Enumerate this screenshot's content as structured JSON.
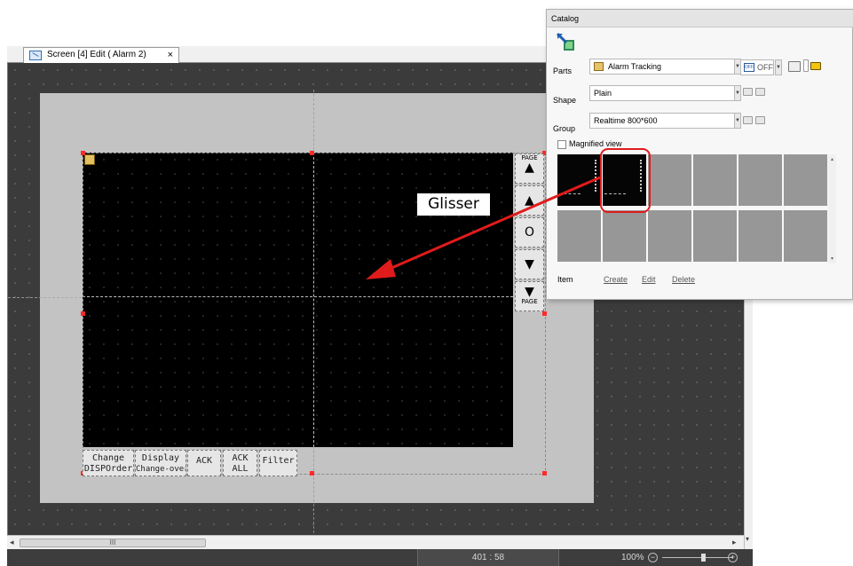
{
  "editor": {
    "tab": {
      "label": "Screen [4] Edit (      Alarm 2)",
      "close": "×"
    },
    "sidebuttons": [
      {
        "name": "page-up",
        "small": "PAGE",
        "glyph": "▲"
      },
      {
        "name": "up",
        "glyph": "▲"
      },
      {
        "name": "center",
        "glyph": "O"
      },
      {
        "name": "down",
        "glyph": "▼"
      },
      {
        "name": "page-down",
        "glyph": "▼",
        "small": "PAGE"
      }
    ],
    "bottombuttons": [
      {
        "line1": "Change",
        "line2": "DISPOrder"
      },
      {
        "line1": "Display",
        "line2": "Change-over"
      },
      {
        "line1": "ACK"
      },
      {
        "line1": "ACK",
        "line2": "ALL"
      },
      {
        "line1": "Filter"
      }
    ],
    "hscroll": {
      "left_arrow": "◂",
      "right_arrow": "▸",
      "grip": "III"
    },
    "vscroll": {
      "up_arrow": "▴",
      "down_arrow": "▾"
    },
    "status": {
      "coord": "401 : 58",
      "zoom": "100%"
    }
  },
  "catalog": {
    "title": "Catalog",
    "parts_label": "Parts",
    "parts_value": "Alarm Tracking",
    "offstate": "OFF",
    "officon": "OFF",
    "shape_label": "Shape",
    "shape_value": "Plain",
    "group_label": "Group",
    "group_value": "Realtime 800*600",
    "magnified_label": "Magnified view",
    "item_label": "Item",
    "create_label": "Create",
    "edit_label": "Edit",
    "delete_label": "Delete"
  },
  "annotation": {
    "glisser": "Glisser"
  },
  "colors": {
    "canvas": "#3b3b3b",
    "screen": "#c3c3c3",
    "display": "#000000",
    "highlight": "#e01b1b",
    "handle": "#ff2a2a"
  }
}
